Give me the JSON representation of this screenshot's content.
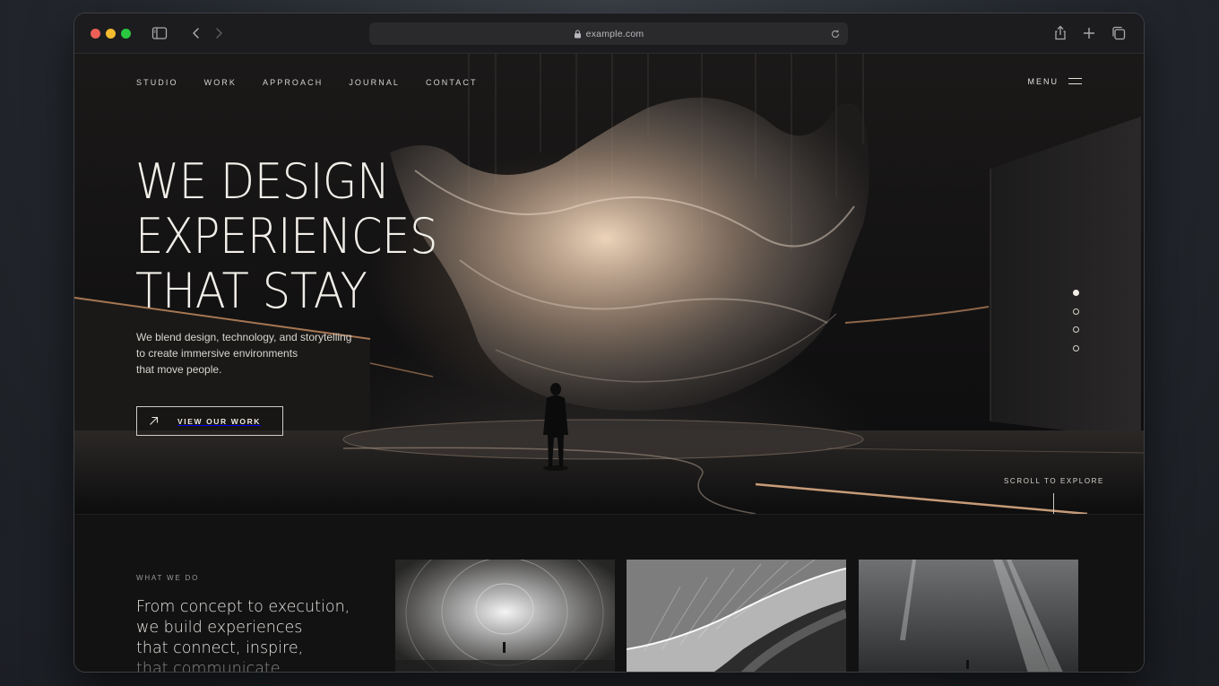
{
  "browser": {
    "url": "example.com"
  },
  "nav": {
    "items": [
      "STUDIO",
      "WORK",
      "APPROACH",
      "JOURNAL",
      "CONTACT"
    ],
    "menu_label": "MENU"
  },
  "hero": {
    "headline": [
      "WE DESIGN",
      "EXPERIENCES",
      "THAT STAY"
    ],
    "subtext": [
      "We blend design, technology, and storytelling",
      "to create immersive environments",
      "that move people."
    ],
    "cta_label": "VIEW OUR WORK",
    "slide_count": 4,
    "active_slide": 1,
    "scroll_label": "SCROLL TO EXPLORE"
  },
  "section": {
    "kicker": "WHAT WE DO",
    "text": [
      "From concept to execution,",
      "we build experiences",
      "that connect, inspire,",
      "that communicate"
    ]
  },
  "icons": {
    "toolbar": [
      "sidebar-icon",
      "back-icon",
      "forward-icon",
      "lock-icon",
      "reload-icon",
      "share-icon",
      "new-tab-icon",
      "tabs-icon"
    ],
    "cta": "arrow-up-right-icon",
    "menu": "hamburger-icon"
  },
  "colors": {
    "traffic_red": "#ed5f57",
    "traffic_yellow": "#f3bb2f",
    "traffic_green": "#29c840",
    "hero_text": "#f2efea"
  }
}
